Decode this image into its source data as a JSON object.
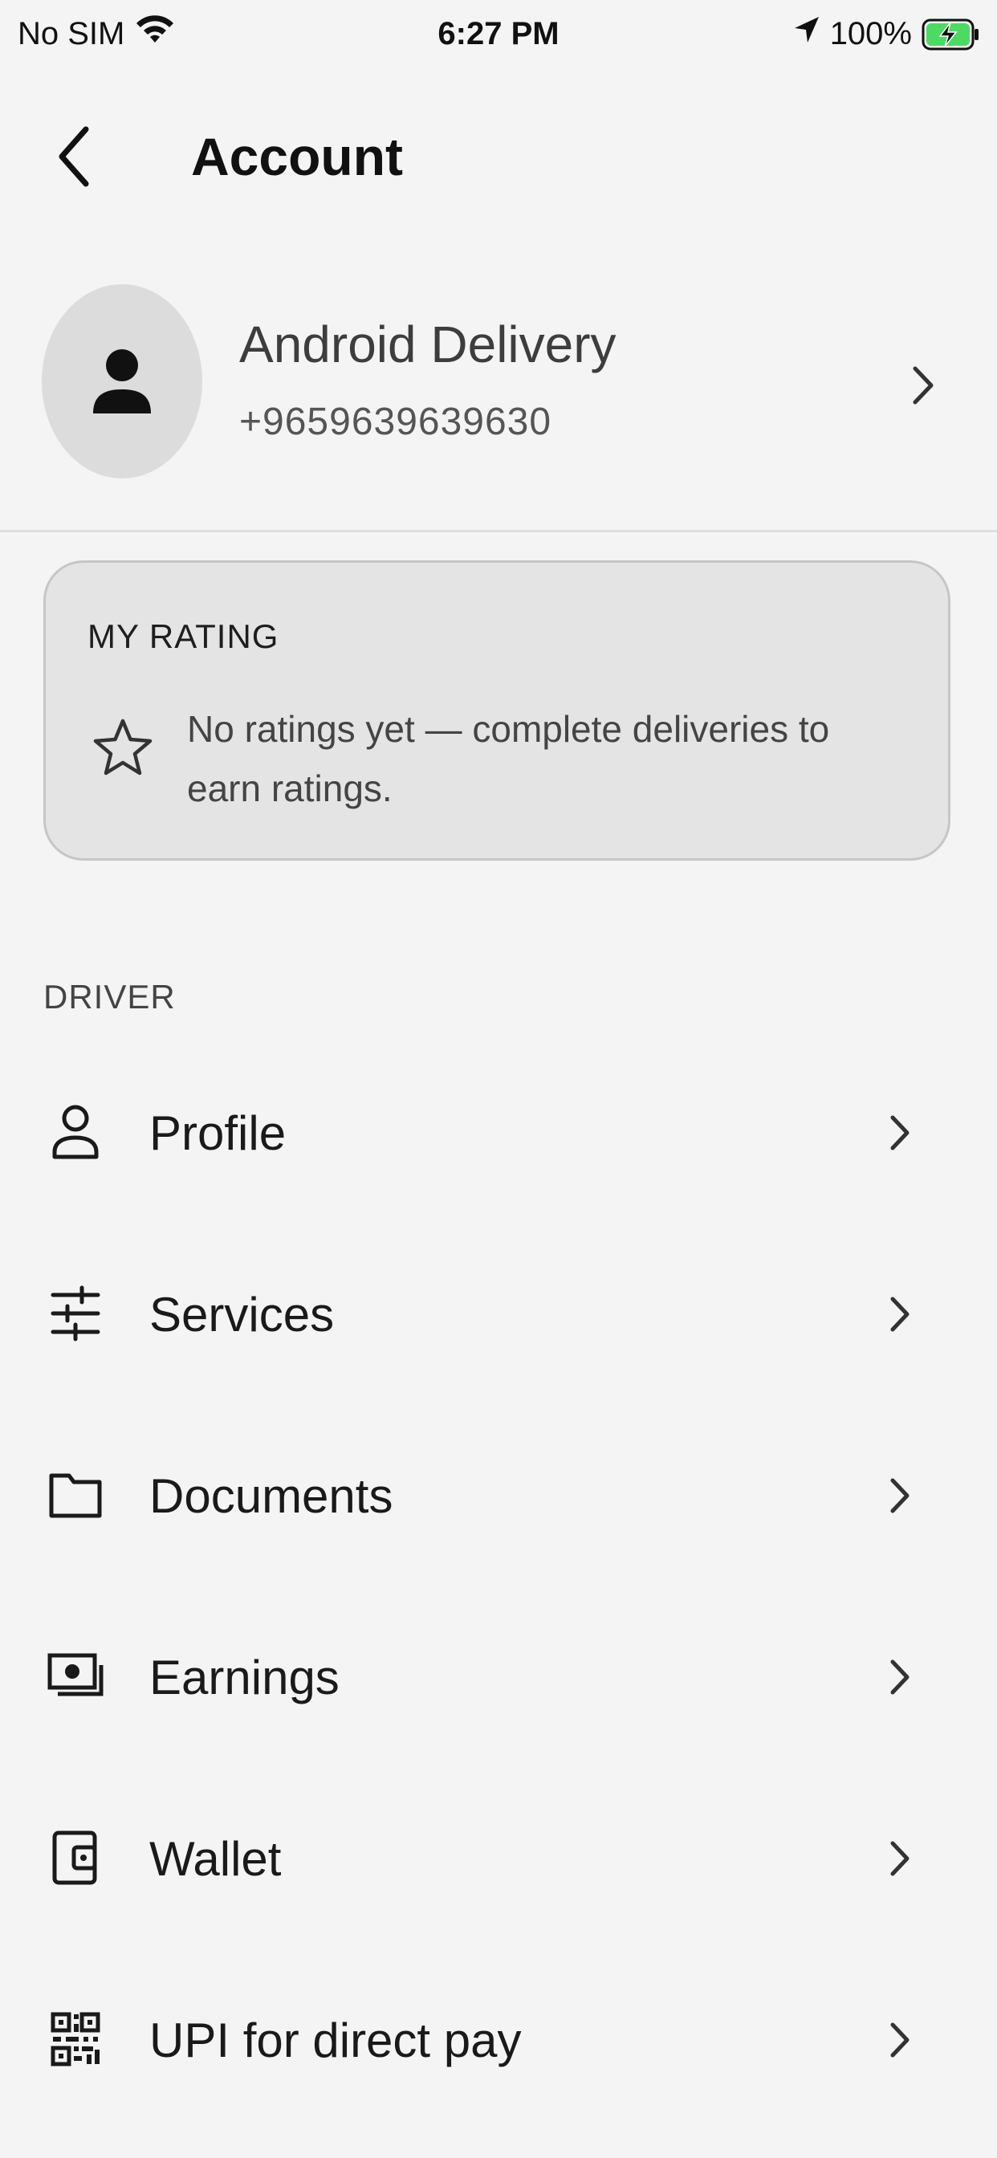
{
  "status_bar": {
    "carrier": "No SIM",
    "time": "6:27 PM",
    "battery": "100%",
    "icons": [
      "wifi-icon",
      "location-arrow-icon",
      "battery-charging-icon"
    ]
  },
  "header": {
    "title": "Account",
    "back_icon": "chevron-left-icon"
  },
  "profile": {
    "name": "Android Delivery",
    "phone": "+9659639639630",
    "avatar_icon": "person-icon"
  },
  "rating": {
    "label": "MY RATING",
    "message": "No ratings yet — complete deliveries to earn ratings.",
    "icon": "star-outline-icon"
  },
  "section": {
    "label": "DRIVER",
    "items": [
      {
        "label": "Profile",
        "icon": "person-outline-icon"
      },
      {
        "label": "Services",
        "icon": "sliders-icon"
      },
      {
        "label": "Documents",
        "icon": "folder-icon"
      },
      {
        "label": "Earnings",
        "icon": "cash-icon"
      },
      {
        "label": "Wallet",
        "icon": "wallet-icon"
      },
      {
        "label": "UPI for direct pay",
        "icon": "qr-code-icon"
      }
    ]
  },
  "colors": {
    "background": "#f4f4f4",
    "card": "#e4e4e4",
    "avatar": "#dcdcdc",
    "battery_charge": "#4cd964"
  }
}
